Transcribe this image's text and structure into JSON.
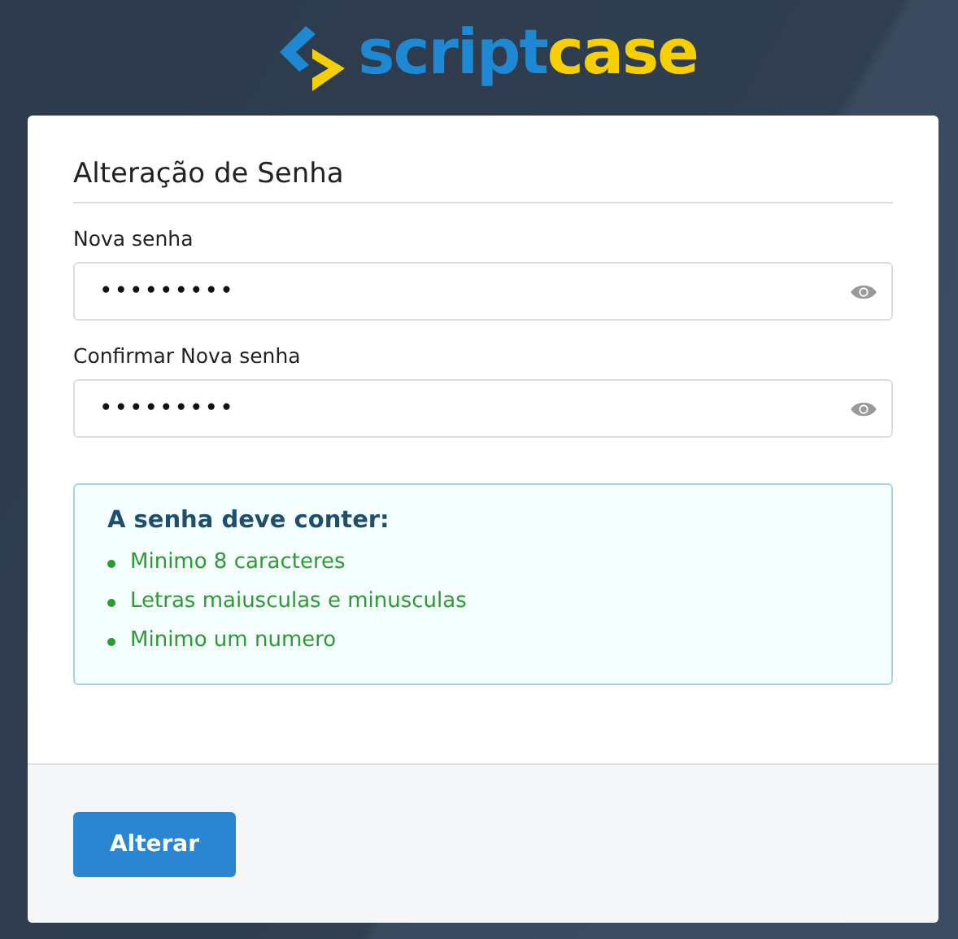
{
  "logo": {
    "primary": "script",
    "secondary": "case"
  },
  "form": {
    "title": "Alteração de Senha",
    "fields": [
      {
        "label": "Nova senha",
        "value": "•••••••••"
      },
      {
        "label": "Confirmar Nova senha",
        "value": "•••••••••"
      }
    ],
    "requirements": {
      "title": "A senha deve conter:",
      "items": [
        {
          "text": "Minimo 8 caracteres",
          "met": true
        },
        {
          "text": "Letras maiusculas e minusculas",
          "met": true
        },
        {
          "text": "Minimo um numero",
          "met": true
        }
      ]
    }
  },
  "submit_button": "Alterar"
}
